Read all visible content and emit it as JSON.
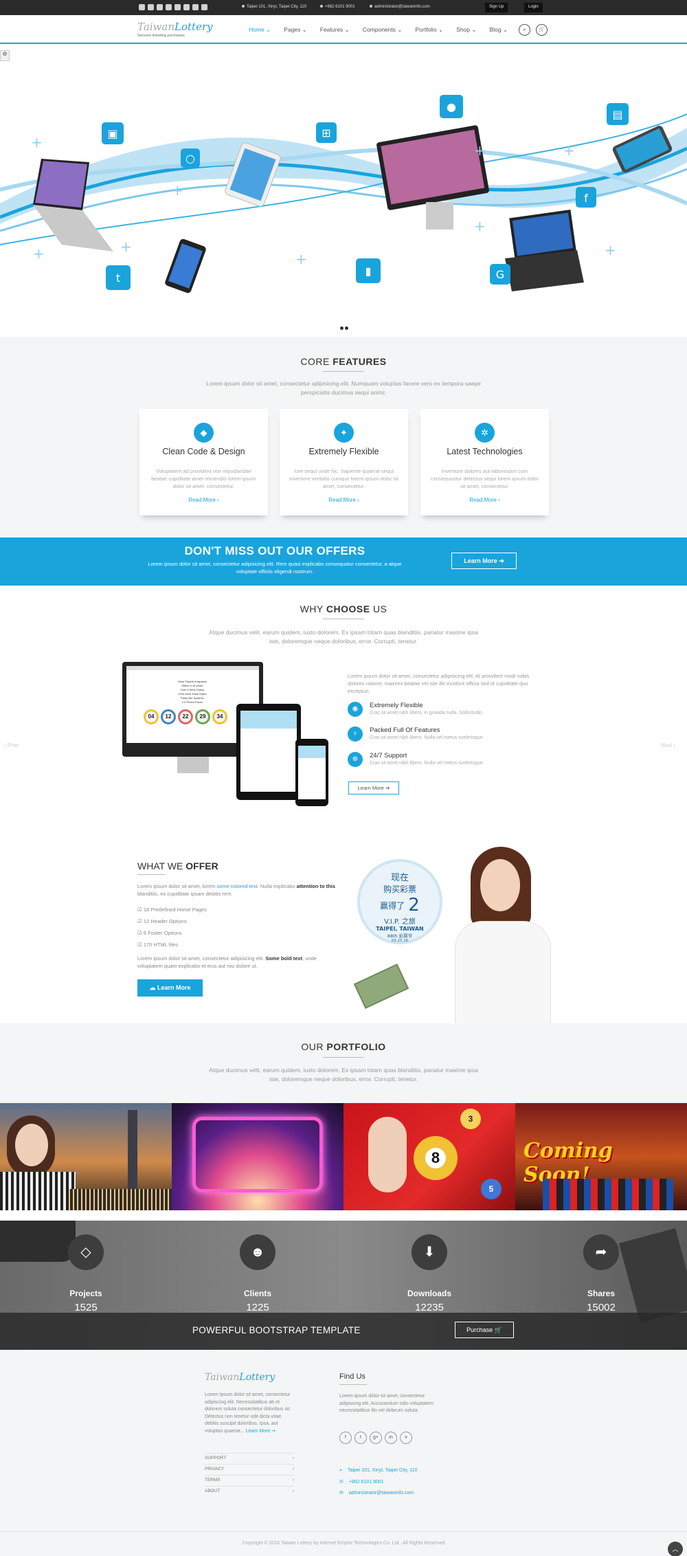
{
  "topbar": {
    "address": "Taipei 101, Xinyi, Taipei City, 110",
    "phone": "+862 6101 9001",
    "email": "administrator@taiwaninfo.com",
    "signup": "Sign Up",
    "login": "Login",
    "social_icons": [
      "twitter-icon",
      "skype-icon",
      "linkedin-icon",
      "google-plus-icon",
      "youtube-icon",
      "vimeo-icon",
      "facebook-icon",
      "dribbble-icon"
    ]
  },
  "nav": {
    "logo_part1": "Taiwan",
    "logo_part2": "Lottery",
    "logo_tagline": "Secures ticketing purchases",
    "items": [
      "Home",
      "Pages",
      "Features",
      "Components",
      "Portfolio",
      "Shop",
      "Blog"
    ],
    "active": "Home",
    "search_glyph": "⌕",
    "cart_glyph": "🛒"
  },
  "features": {
    "title_light": "CORE ",
    "title_bold": "FEATURES",
    "subtitle": "Lorem ipsum dolor sit amet, consectetur adipisicing elit. Numquam voluptas facere vero ex tempora saepe perspiciatis ducimus sequi animi.",
    "boxes": [
      {
        "icon": "◆",
        "title": "Clean Code & Design",
        "text": "Voluptatem ad provident non repudiandae beatae cupiditate amet reiciendis lorem ipsum dolor sit amet, consectetur.",
        "link": "Read More ›"
      },
      {
        "icon": "✦",
        "title": "Extremely Flexible",
        "text": "Iure sequi unde hic. Sapiente quaerat sequi inventore veritatis cumque lorem ipsum dolor sit amet, consectetur.",
        "link": "Read More ›"
      },
      {
        "icon": "✲",
        "title": "Latest Technologies",
        "text": "Inventore dolores aut laboriosam cum consequuntur delectus sequi lorem ipsum dolor sit amet, consectetur.",
        "link": "Read More ›"
      }
    ]
  },
  "cta": {
    "title": "DON'T MISS OUT OUR OFFERS",
    "text": "Lorem ipsum dolor sit amet, consectetur adipisicing elit. Rem quasi explicabo consequatur consectetur, a atque voluptate officiis eligendi nostrum.",
    "button": "Learn More  ➔"
  },
  "why": {
    "title_light": "WHY ",
    "title_bold": "CHOOSE",
    "title_end": " US",
    "subtitle": "Atque ducimus velit, earum quidem, iusto dolorem. Ex ipsam totam quas blanditiis, pariatur maxime ipsa iste, doloremque neque doloribus, error. Corrupti, tenetur.",
    "intro": "Lorem ipsum dolor sit amet, consectetur adipisicing elit. At provident modi nobis dolores ratione, maiores beatae vel iste illo incidunt officia sed id cupiditate quo excepturi.",
    "bullets": [
      {
        "icon": "◉",
        "title": "Extremely Flexible",
        "text": "Cras sit amet nibh libero, in gravida nulla. Sollicitudin."
      },
      {
        "icon": "♆",
        "title": "Packed Full Of Features",
        "text": "Cras sit amet nibh libero. Nulla vel metus scelerisque."
      },
      {
        "icon": "⊕",
        "title": "24/7 Support",
        "text": "Cras sit amet nibh libero. Nulla vel metus scelerisque."
      }
    ],
    "button": "Learn More  ➔",
    "prev": "‹ Prev",
    "next": "Next ›",
    "screen_lines": [
      "Draw Tickets Irregularly",
      "Within a 45 years",
      "Over 5 Win5 Draws",
      "1000 More Draw Dates",
      "Parity Bet Systems",
      "2 5 Prized Prizes"
    ],
    "balls": [
      "04",
      "12",
      "22",
      "29",
      "34"
    ]
  },
  "offer": {
    "title_light": "WHAT WE ",
    "title_bold": "OFFER",
    "p1_a": "Lorem ipsum dolor sit amet, lorem ",
    "p1_link": "some colored text",
    "p1_b": ". Nulla explicabo ",
    "p1_bold": "attention to this",
    "p1_c": " blanditiis, ex cupiditate ipsam debitis rem.",
    "list": [
      "18 Predefined Home Pages",
      "12 Header Options",
      "6 Footer Options",
      "170 HTML files"
    ],
    "p2_a": "Lorem ipsum dolor sit amet, consectetur adipisicing elit. ",
    "p2_bold": "Some bold text",
    "p2_b": ", unde voluptatem quam explicabo et eius aut nisi dolore ut.",
    "button": "☁ Learn More",
    "seal_lines": [
      "现在",
      "购买彩票",
      "赢得了",
      "2",
      "V.I.P. 之旅",
      "TAIPEI, TAIWAN",
      "88th 彩票节",
      "03.25.16"
    ]
  },
  "portfolio": {
    "title_light": "OUR ",
    "title_bold": "PORTFOLIO",
    "subtitle": "Atque ducimus velit, earum quidem, iusto dolorem. Ex ipsam totam quas blanditiis, pariatur maxime ipsa iste, doloremque neque doloribus, error. Corrupti, tenetur.",
    "coming_soon": "Coming Soon!",
    "ball_number": "8",
    "ball_small": [
      "3",
      "5"
    ]
  },
  "stats": [
    {
      "icon": "◇",
      "label": "Projects",
      "value": "1525"
    },
    {
      "icon": "☻",
      "label": "Clients",
      "value": "1225"
    },
    {
      "icon": "⬇",
      "label": "Downloads",
      "value": "12235"
    },
    {
      "icon": "➦",
      "label": "Shares",
      "value": "15002"
    }
  ],
  "purchase": {
    "title": "POWERFUL BOOTSTRAP TEMPLATE",
    "button": "Purchase  🛒"
  },
  "footer": {
    "about": "Lorem ipsum dolor sit amet, consectetur adipiscing elit. Necessitatibus ab et dolorem soluta consectetur doloribus sit. Delectus non tenetur odit dicta vitae debitis suscipit doloribus. Ipsa, aut voluptas quaerat...",
    "about_link": "Learn More ➞",
    "links": [
      "SUPPORT",
      "PRIVACY",
      "TERMS",
      "ABOUT"
    ],
    "link_arrow": "›",
    "find_title": "Find Us",
    "find_text": "Lorem ipsum dolor sit amet, consectetur adipiscing elit. Accusantium odio voluptatem necessitatibus illo vel dolorum soluta.",
    "social": [
      "f",
      "t",
      "g+",
      "in",
      "v"
    ],
    "contact": [
      {
        "icon": "⌖",
        "text": "Taipei 101, Xinyi, Taipei City, 110"
      },
      {
        "icon": "✆",
        "text": "+862 6101 9001"
      },
      {
        "icon": "✉",
        "text": "administrator@taiwaninfo.com"
      }
    ],
    "copyright": "Copyright © 2016 Taiwan Lottery by Internet Empire Technologies Co. Ltd.. All Rights Reserved",
    "to_top": "︿"
  },
  "colors": {
    "accent": "#1aa4dc",
    "dark": "#2a2a2a"
  }
}
